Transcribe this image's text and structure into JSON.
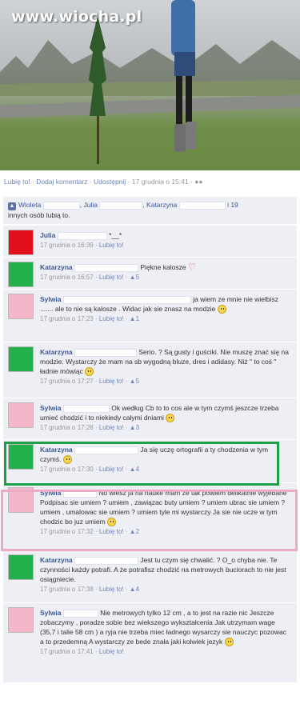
{
  "photo": {
    "watermark": "www.wiocha.pl"
  },
  "photo_bar": {
    "like": "Lubię to!",
    "add_comment": "Dodaj komentarz",
    "share": "Udostępnij",
    "date": "17 grudnia o 15:41"
  },
  "likes": {
    "name1": "Wioleta",
    "name2": "Julia",
    "name3": "Katarzyna",
    "count_text": "i 19",
    "tail": "innych osób lubią to."
  },
  "comments": [
    {
      "name": "Julia",
      "text": "*__*",
      "time": "17 grudnia o 16:39",
      "like": "Lubię to!",
      "likes": "",
      "avatar_color": "#e2101c"
    },
    {
      "name": "Katarzyna",
      "text": "Piękne kalosze",
      "time": "17 grudnia o 16:57",
      "like": "Lubię to!",
      "likes": "5",
      "avatar_color": "#21b04b"
    },
    {
      "name": "Sylwia",
      "text": "ja wiem ze mnie nie wielbisz ....... ale to nie są kalosze . Widac jak sie znasz na modzie",
      "time": "17 grudnia o 17:23",
      "like": "Lubię to!",
      "likes": "1",
      "avatar_color": "#f4b6c8"
    },
    {
      "name": "Katarzyna",
      "text": "Serio. ? Są gusty i guściki. Nie muszę znać się na modzie. Wystarczy że mam na sb wygodną bluze, dres i adidasy. Niż \" to coś \" ładnie mówiąc",
      "time": "17 grudnia o 17:27",
      "like": "Lubię to!",
      "likes": "5",
      "avatar_color": "#21b04b"
    },
    {
      "name": "Sylwia",
      "text": "Ok według Cb to to cos ale w tym czymś jeszcze trzeba umieć chodzić i to niekiedy całymi dniami",
      "time": "17 grudnia o 17:28",
      "like": "Lubię to!",
      "likes": "3",
      "avatar_color": "#f4b6c8"
    },
    {
      "name": "Katarzyna",
      "text": "Ja się uczę ortografii a ty chodzenia w tym czymś.",
      "time": "17 grudnia o 17:30",
      "like": "Lubię to!",
      "likes": "4",
      "avatar_color": "#21b04b"
    },
    {
      "name": "Sylwia",
      "text": "No wiesz ja na nauke mam ze tak powiem delikatnie wyjebane  Podpisac sie umiem ? umiem , zawiązac buty umiem ? umiem  ubrac sie umiem ? umiem , umalowac sie umiem ? umiem  tyle mi wystarczy  Ja sie nie ucze w tym chodzic bo juz umiem",
      "time": "17 grudnia o 17:32",
      "like": "Lubię to!",
      "likes": "2",
      "avatar_color": "#f4b6c8"
    },
    {
      "name": "Katarzyna",
      "text": "Jest tu czym się chwalić. ? O_o chyba nie. Te czynności każdy potrafi. A że potrafisz chodzić na metrowych buciorach to nie jest osiągniecie.",
      "time": "17 grudnia o 17:38",
      "like": "Lubię to!",
      "likes": "4",
      "avatar_color": "#21b04b"
    },
    {
      "name": "Sylwia",
      "text": "Nie metrowych tylko 12 cm , a to jest na razie nic  Jeszcze zobaczymy , poradze sobie bez wiekszego wykształcenia  Jak utrzymam wage (35,7 i talie 58 cm ) a ryja nie trzeba miec ładnego wysarczy sie nauczyc pozowac a to przedemną  A wystarczy ze bede znała jaki kolwiek jezyk",
      "time": "17 grudnia o 17:41",
      "like": "Lubię to!",
      "likes": "",
      "avatar_color": "#f4b6c8"
    }
  ]
}
